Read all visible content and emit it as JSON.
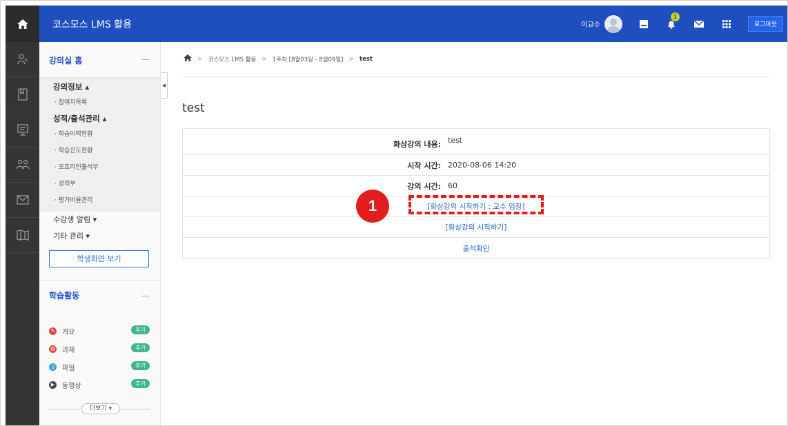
{
  "header": {
    "site_title": "코스모스 LMS 활용",
    "user_name": "이교수",
    "notification_count": "1",
    "logout_label": "로그아웃"
  },
  "rail": {
    "icons": [
      "person-icon",
      "book-icon",
      "board-icon",
      "group-icon",
      "mail-icon",
      "map-icon"
    ]
  },
  "sidebar": {
    "home_label": "강의실 홈",
    "sections": [
      {
        "label": "강의정보 ▴",
        "items": [
          "· 참여자목록"
        ]
      },
      {
        "label": "성적/출석관리 ▴",
        "items": [
          "· 학습이력현황",
          "· 학습진도현황",
          "· 오프라인출석부",
          "· 성적부",
          "· 평가비율관리"
        ]
      }
    ],
    "plain_items": [
      "수강생 알림 ▾",
      "기타 관리 ▾"
    ],
    "student_view_button": "학생화면 보기",
    "activities_label": "학습활동",
    "activities": [
      {
        "label": "개요",
        "add": "추가",
        "color": "#e04a3c",
        "icon": "overview-icon"
      },
      {
        "label": "과제",
        "add": "추가",
        "color": "#e04a3c",
        "icon": "assignment-icon"
      },
      {
        "label": "파일",
        "add": "추가",
        "color": "#3fa3d8",
        "icon": "file-icon"
      },
      {
        "label": "동영상",
        "add": "추가",
        "color": "#444444",
        "icon": "video-icon"
      }
    ],
    "more_button": "더보기 ▾"
  },
  "breadcrumb": {
    "items": [
      "코스모스 LMS 활용",
      "1주차 [8월03일 - 8월09일]"
    ],
    "current": "test"
  },
  "main": {
    "title": "test",
    "rows": [
      {
        "label": "화상강의 내용:",
        "value": "test"
      },
      {
        "label": "시작 시간:",
        "value": "2020-08-06 14:20"
      },
      {
        "label": "강의 시간:",
        "value": "60"
      }
    ],
    "links": {
      "professor_start": "[화상강의 시작하기 : 교수 입장]",
      "start": "[화상강의 시작하기]",
      "attendance": "출석확인"
    }
  },
  "annotation": {
    "marker": "1",
    "color": "#e21d1d"
  },
  "colors": {
    "header_blue": "#1f4fbf",
    "link_blue": "#2a64c5",
    "rail_dark": "#353535",
    "add_green": "#3fb68b"
  }
}
